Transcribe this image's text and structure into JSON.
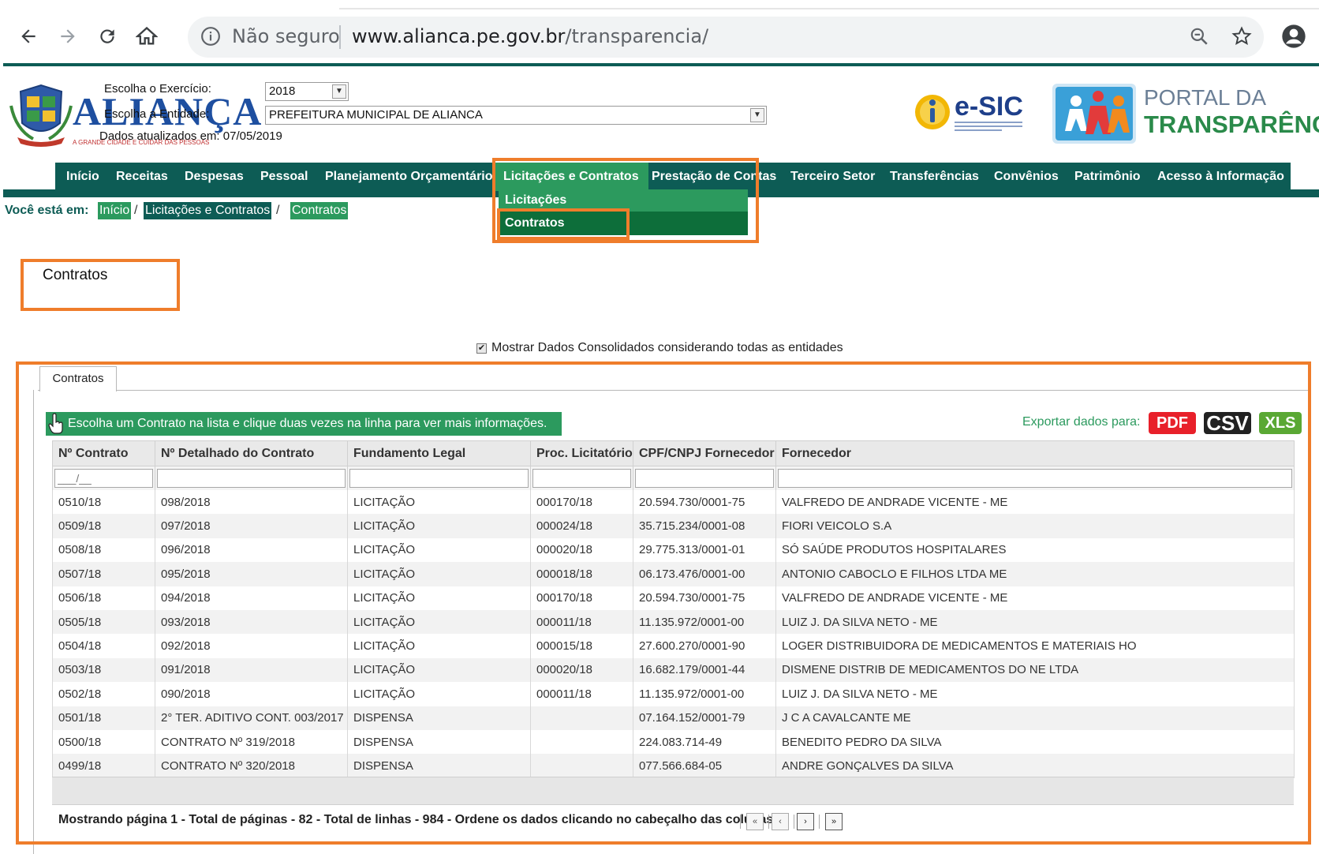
{
  "browser": {
    "security_label": "Não seguro",
    "url_host": "www.alianca.pe.gov.br",
    "url_path": "/transparencia/"
  },
  "header": {
    "logo_text": "ALIANÇA",
    "logo_tagline": "A GRANDE CIDADE E CUIDAR DAS PESSOAS",
    "exercise_label": "Escolha o Exercício:",
    "exercise_value": "2018",
    "entity_label": "Escolha a Entidade:",
    "entity_value": "PREFEITURA MUNICIPAL DE ALIANCA",
    "updated_label": "Dados atualizados em:",
    "updated_value": "07/05/2019",
    "esic_text": "e-SIC",
    "portal_line1": "PORTAL DA",
    "portal_line2": "TRANSPARÊNCIA"
  },
  "menu": {
    "items": [
      "Início",
      "Receitas",
      "Despesas",
      "Pessoal",
      "Planejamento Orçamentário",
      "Licitações e Contratos",
      "Prestação de Contas",
      "Terceiro Setor",
      "Transferências",
      "Convênios",
      "Patrimônio",
      "Acesso à Informação"
    ],
    "dropdown": [
      "Licitações",
      "Contratos"
    ]
  },
  "breadcrumb": {
    "label": "Você está em:",
    "items": [
      "Início",
      "Licitações e Contratos",
      "Contratos"
    ]
  },
  "page": {
    "title": "Contratos",
    "consolidated_label": "Mostrar Dados Consolidados considerando todas as entidades",
    "consolidated_checked": true,
    "tab": "Contratos",
    "banner": "Escolha um Contrato na lista e clique duas vezes na linha para ver mais informações.",
    "export_label": "Exportar dados para:",
    "export_buttons": [
      "PDF",
      "CSV",
      "XLS"
    ],
    "export_colors": [
      "#e8202a",
      "#222222",
      "#5aa834"
    ]
  },
  "grid": {
    "columns": [
      "Nº Contrato",
      "Nº Detalhado do Contrato",
      "Fundamento Legal",
      "Proc. Licitatório",
      "CPF/CNPJ Fornecedor",
      "Fornecedor"
    ],
    "contract_filter_placeholder": "___/__",
    "rows": [
      [
        "0510/18",
        "098/2018",
        "LICITAÇÃO",
        "000170/18",
        "20.594.730/0001-75",
        "VALFREDO DE ANDRADE VICENTE - ME"
      ],
      [
        "0509/18",
        "097/2018",
        "LICITAÇÃO",
        "000024/18",
        "35.715.234/0001-08",
        "FIORI VEICOLO S.A"
      ],
      [
        "0508/18",
        "096/2018",
        "LICITAÇÃO",
        "000020/18",
        "29.775.313/0001-01",
        "SÓ SAÚDE PRODUTOS HOSPITALARES"
      ],
      [
        "0507/18",
        "095/2018",
        "LICITAÇÃO",
        "000018/18",
        "06.173.476/0001-00",
        "ANTONIO CABOCLO E FILHOS LTDA ME"
      ],
      [
        "0506/18",
        "094/2018",
        "LICITAÇÃO",
        "000170/18",
        "20.594.730/0001-75",
        "VALFREDO DE ANDRADE VICENTE - ME"
      ],
      [
        "0505/18",
        "093/2018",
        "LICITAÇÃO",
        "000011/18",
        "11.135.972/0001-00",
        "LUIZ J. DA SILVA NETO - ME"
      ],
      [
        "0504/18",
        "092/2018",
        "LICITAÇÃO",
        "000015/18",
        "27.600.270/0001-90",
        "LOGER DISTRIBUIDORA DE MEDICAMENTOS E MATERIAIS HO"
      ],
      [
        "0503/18",
        "091/2018",
        "LICITAÇÃO",
        "000020/18",
        "16.682.179/0001-44",
        "DISMENE DISTRIB DE MEDICAMENTOS DO NE LTDA"
      ],
      [
        "0502/18",
        "090/2018",
        "LICITAÇÃO",
        "000011/18",
        "11.135.972/0001-00",
        "LUIZ J. DA SILVA NETO - ME"
      ],
      [
        "0501/18",
        "2° TER. ADITIVO CONT. 003/2017",
        "DISPENSA",
        "",
        "07.164.152/0001-79",
        "J C A CAVALCANTE ME"
      ],
      [
        "0500/18",
        "CONTRATO Nº 319/2018",
        "DISPENSA",
        "",
        "224.083.714-49",
        "BENEDITO PEDRO DA SILVA"
      ],
      [
        "0499/18",
        "CONTRATO Nº 320/2018",
        "DISPENSA",
        "",
        "077.566.684-05",
        "ANDRE GONÇALVES DA SILVA"
      ]
    ],
    "pager_text": "Mostrando página 1 - Total de páginas - 82 - Total de linhas - 984 - Ordene os dados clicando no cabeçalho das colunas."
  }
}
